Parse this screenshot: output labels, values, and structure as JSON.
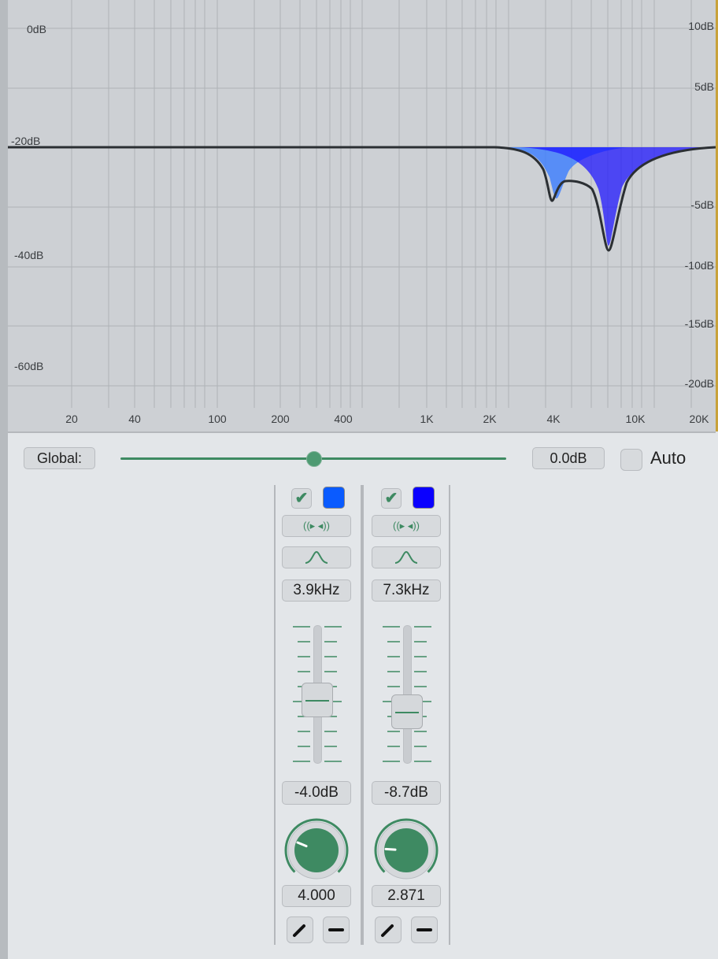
{
  "graph": {
    "left_db_labels": [
      "0dB",
      "-20dB",
      "-40dB",
      "-60dB"
    ],
    "right_db_labels": [
      "10dB",
      "5dB",
      "-5dB",
      "-10dB",
      "-15dB",
      "-20dB"
    ],
    "freq_labels": [
      "20",
      "40",
      "100",
      "200",
      "400",
      "1K",
      "2K",
      "4K",
      "10K",
      "20K"
    ]
  },
  "global": {
    "label": "Global:",
    "value": "0.0dB",
    "slider_fraction": 0.5,
    "auto_label": "Auto",
    "auto_checked": false
  },
  "bands": [
    {
      "enabled": true,
      "color": "#0a5bff",
      "freq": "3.9kHz",
      "gain": "-4.0dB",
      "q": "4.000",
      "fader_fraction": 0.57,
      "knob_fraction": 0.25
    },
    {
      "enabled": true,
      "color": "#0a00ff",
      "freq": "7.3kHz",
      "gain": "-8.7dB",
      "q": "2.871",
      "fader_fraction": 0.66,
      "knob_fraction": 0.18
    }
  ],
  "icons": {
    "enable": "check-icon",
    "solo": "solo-speaker-icon",
    "filter_shape": "bell-curve-icon",
    "edit": "pencil-icon",
    "remove": "minus-icon"
  }
}
